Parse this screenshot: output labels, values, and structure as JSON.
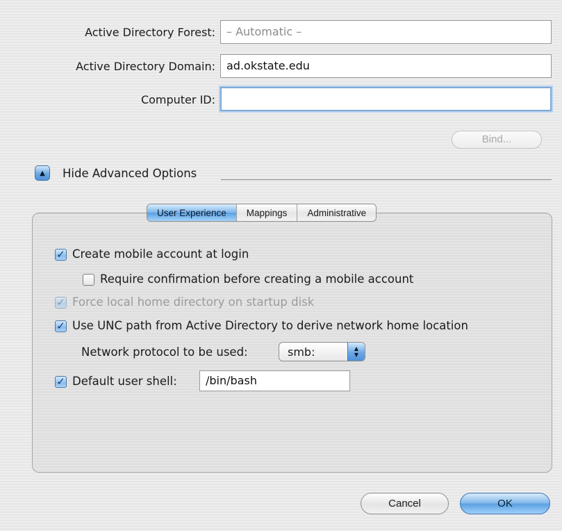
{
  "form": {
    "forest_label": "Active Directory Forest:",
    "forest_value": "– Automatic –",
    "domain_label": "Active Directory Domain:",
    "domain_value": "ad.okstate.edu",
    "computer_id_label": "Computer ID:",
    "computer_id_value": "",
    "bind_label": "Bind..."
  },
  "advanced": {
    "toggle_label": "Hide Advanced Options",
    "toggle_icon": "triangle-up-icon"
  },
  "tabs": [
    {
      "label": "User Experience",
      "active": true
    },
    {
      "label": "Mappings",
      "active": false
    },
    {
      "label": "Administrative",
      "active": false
    }
  ],
  "options": {
    "mobile_account": {
      "label": "Create mobile account at login",
      "checked": true
    },
    "require_confirmation": {
      "label": "Require confirmation before creating a mobile account",
      "checked": false
    },
    "force_local_home": {
      "label": "Force local home directory on startup disk",
      "checked": true,
      "enabled": false
    },
    "use_unc_path": {
      "label": "Use UNC path from Active Directory to derive network home location",
      "checked": true
    },
    "network_protocol": {
      "label": "Network protocol to be used:",
      "value": "smb:"
    },
    "default_shell": {
      "label": "Default user shell:",
      "checked": true,
      "value": "/bin/bash"
    }
  },
  "buttons": {
    "cancel_label": "Cancel",
    "ok_label": "OK"
  },
  "colors": {
    "accent": "#6ca8e4",
    "focus_ring": "#7fa9d6",
    "window_bg": "#ececec"
  }
}
